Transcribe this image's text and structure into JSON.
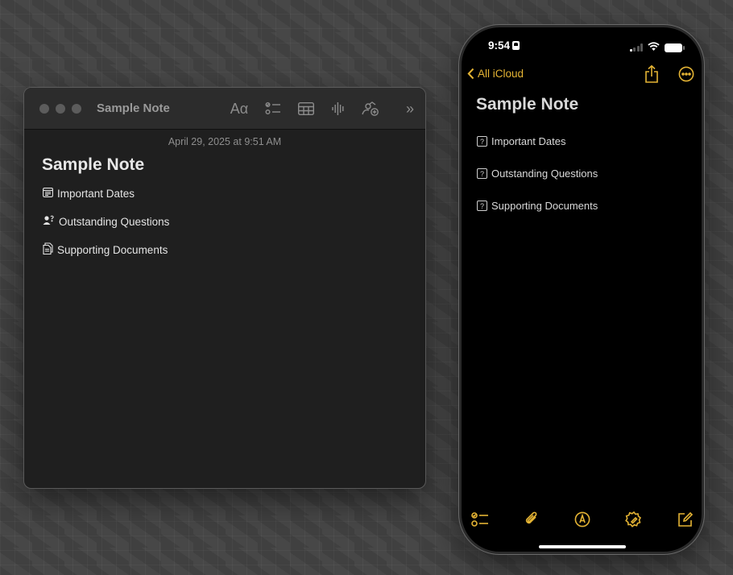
{
  "mac": {
    "window_title": "Sample Note",
    "toolbar": {
      "format_glyph": "Aα",
      "more_glyph": "»",
      "icons": [
        "format-icon",
        "checklist-icon",
        "table-icon",
        "audio-icon",
        "collaborate-icon",
        "more-icon"
      ]
    },
    "date": "April 29, 2025 at 9:51 AM",
    "note_title": "Sample Note",
    "items": [
      {
        "icon": "calendar-icon",
        "label": "Important Dates"
      },
      {
        "icon": "person-question-icon",
        "label": "Outstanding Questions"
      },
      {
        "icon": "documents-icon",
        "label": "Supporting Documents"
      }
    ]
  },
  "phone": {
    "status": {
      "time": "9:54"
    },
    "nav": {
      "back_label": "All iCloud"
    },
    "note_title": "Sample Note",
    "items": [
      {
        "icon": "question-box-icon",
        "placeholder_glyph": "?",
        "label": "Important Dates"
      },
      {
        "icon": "question-box-icon",
        "placeholder_glyph": "?",
        "label": "Outstanding Questions"
      },
      {
        "icon": "question-box-icon",
        "placeholder_glyph": "?",
        "label": "Supporting Documents"
      }
    ],
    "bottom_bar": [
      "checklist-icon",
      "paperclip-icon",
      "markup-icon",
      "apple-intelligence-icon",
      "compose-icon"
    ]
  },
  "colors": {
    "accent": "#e5b434",
    "window_bg": "#1f1f1f",
    "toolbar_bg": "#2c2c2c",
    "phone_bg": "#000000",
    "desktop_bg": "#474747"
  }
}
